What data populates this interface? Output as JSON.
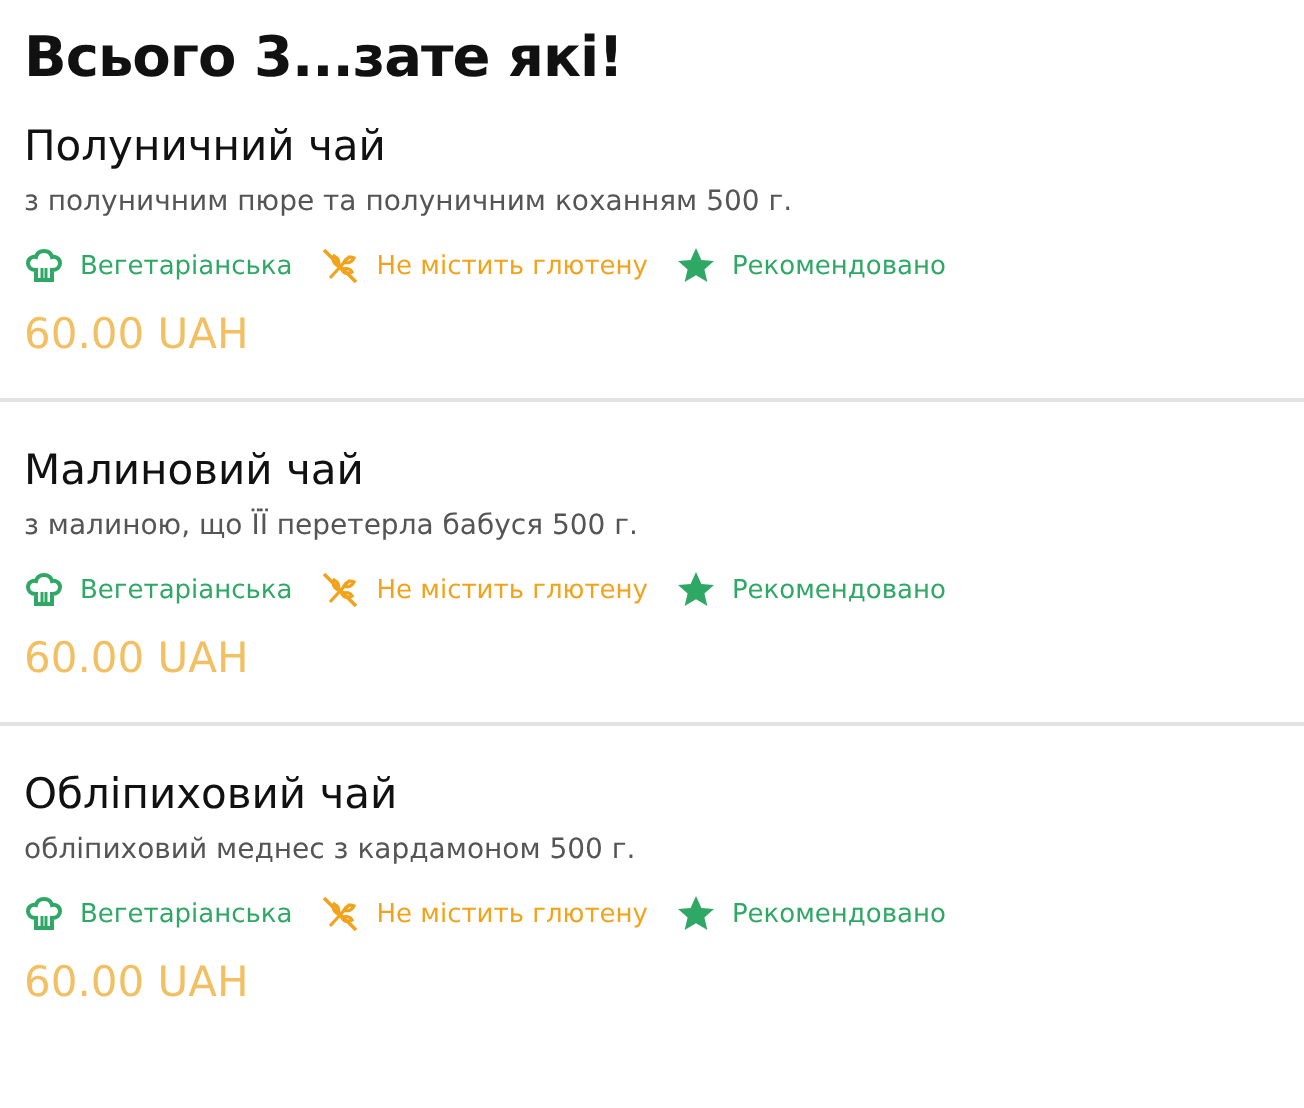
{
  "heading": "Всього 3...зате які!",
  "items": [
    {
      "name": "Полуничний чай",
      "description": "з полуничним пюре та полуничним коханням 500 г.",
      "tags": [
        {
          "kind": "vegetarian",
          "label": "Вегетаріанська"
        },
        {
          "kind": "gluten_free",
          "label": "Не містить глютену"
        },
        {
          "kind": "recommended",
          "label": "Рекомендовано"
        }
      ],
      "price": "60.00 UAH"
    },
    {
      "name": "Малиновий чай",
      "description": "з малиною, що ЇЇ перетерла бабуся 500 г.",
      "tags": [
        {
          "kind": "vegetarian",
          "label": "Вегетаріанська"
        },
        {
          "kind": "gluten_free",
          "label": "Не містить глютену"
        },
        {
          "kind": "recommended",
          "label": "Рекомендовано"
        }
      ],
      "price": "60.00 UAH"
    },
    {
      "name": "Обліпиховий чай",
      "description": "обліпиховий меднес з кардамоном 500 г.",
      "tags": [
        {
          "kind": "vegetarian",
          "label": "Вегетаріанська"
        },
        {
          "kind": "gluten_free",
          "label": "Не містить глютену"
        },
        {
          "kind": "recommended",
          "label": "Рекомендовано"
        }
      ],
      "price": "60.00 UAH"
    }
  ]
}
